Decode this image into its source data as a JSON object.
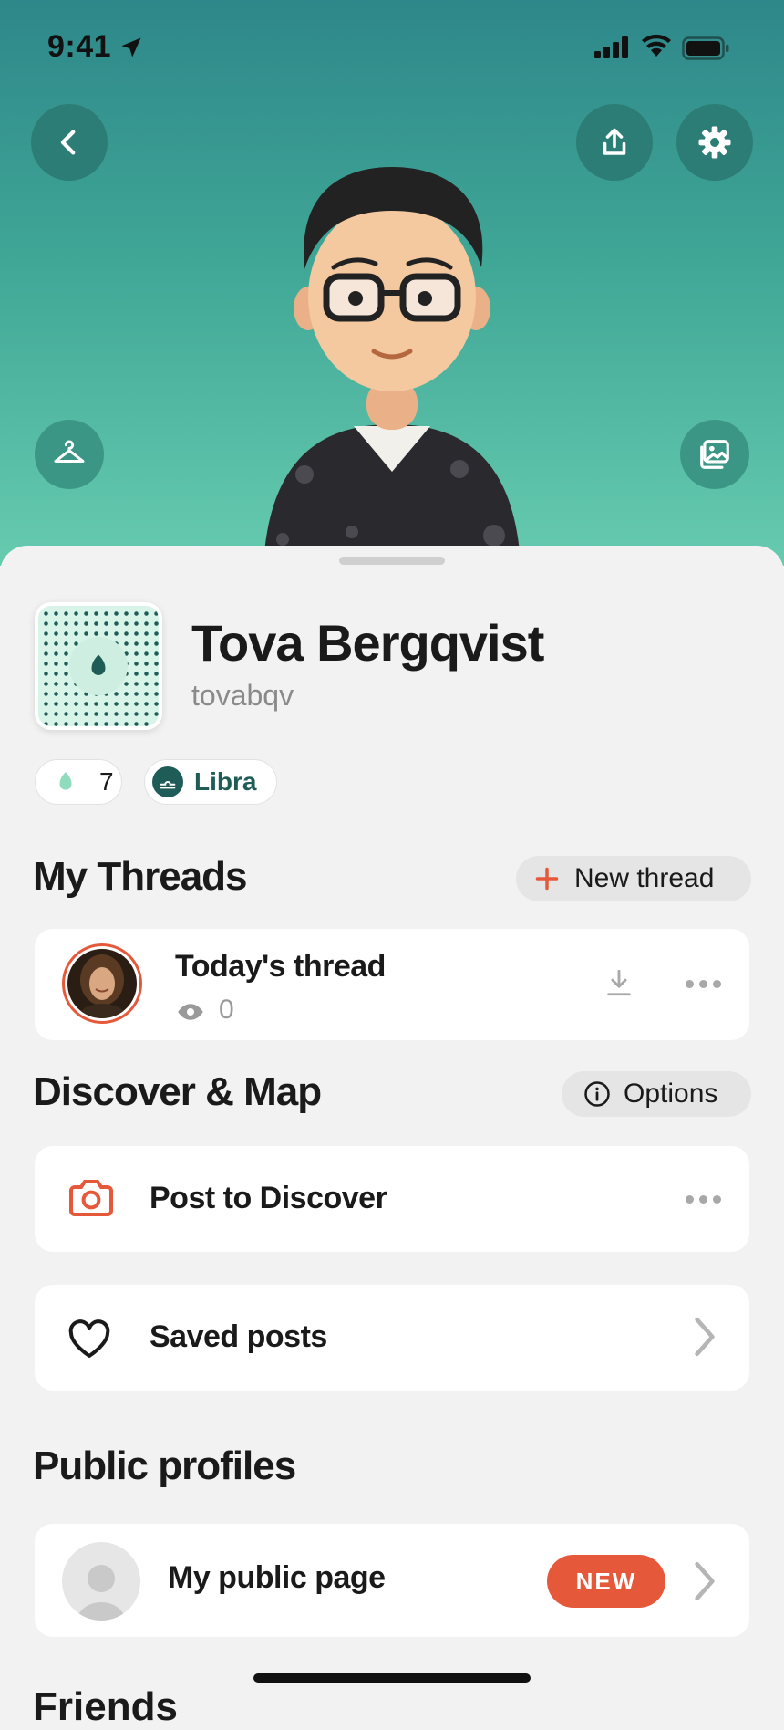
{
  "status_bar": {
    "time": "9:41"
  },
  "profile": {
    "name": "Tova Bergqvist",
    "handle": "tovabqv"
  },
  "badges": [
    {
      "icon": "leaf-icon",
      "value": "7"
    },
    {
      "icon": "libra-icon",
      "label": "Libra"
    }
  ],
  "threads": {
    "title": "My Threads",
    "new_button": "New thread",
    "items": [
      {
        "title": "Today's thread",
        "views": "0"
      }
    ]
  },
  "discover": {
    "title": "Discover & Map",
    "options_button": "Options",
    "items": [
      {
        "icon": "camera-icon",
        "label": "Post to Discover"
      },
      {
        "icon": "heart-icon",
        "label": "Saved posts"
      }
    ]
  },
  "public_profiles": {
    "title": "Public profiles",
    "items": [
      {
        "label": "My public page",
        "badge": "NEW"
      }
    ]
  },
  "next_section_title": "Friends",
  "colors": {
    "accent": "#e5593a",
    "teal": "#2c7d75",
    "libra": "#1f5c57"
  }
}
